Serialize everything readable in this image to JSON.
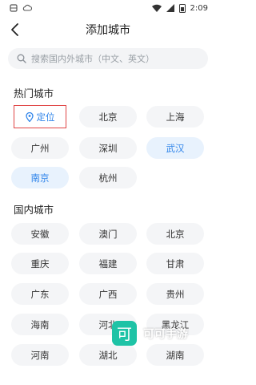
{
  "status_bar": {
    "time": "2:09"
  },
  "header": {
    "title": "添加城市"
  },
  "search": {
    "placeholder": "搜索国内外城市（中文、英文）"
  },
  "hot_section": {
    "title": "热门城市",
    "locate_label": "定位",
    "cities": [
      "北京",
      "上海",
      "广州",
      "深圳",
      "武汉",
      "南京",
      "杭州"
    ],
    "active": [
      "武汉",
      "南京"
    ]
  },
  "domestic_section": {
    "title": "国内城市",
    "cities": [
      "安徽",
      "澳门",
      "北京",
      "重庆",
      "福建",
      "甘肃",
      "广东",
      "广西",
      "贵州",
      "海南",
      "河北",
      "黑龙江",
      "河南",
      "湖北",
      "湖南"
    ]
  },
  "watermark": {
    "text": "可可手游",
    "logo_char": "可"
  },
  "colors": {
    "accent": "#2f84ea",
    "active_bg": "#e8f2fd",
    "chip_bg": "#f4f5f7",
    "highlight_border": "#e04545",
    "watermark_logo": "#1ec3a6"
  }
}
